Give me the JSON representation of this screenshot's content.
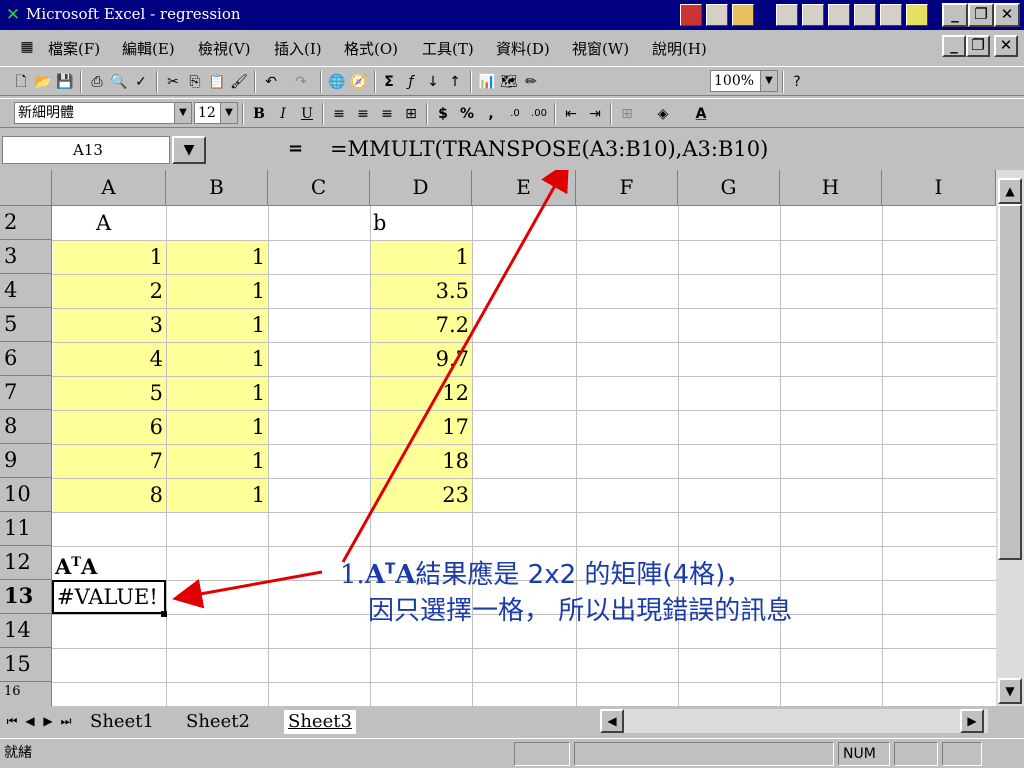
{
  "window": {
    "title": "Microsoft Excel - regression"
  },
  "menu": [
    "檔案(F)",
    "編輯(E)",
    "檢視(V)",
    "插入(I)",
    "格式(O)",
    "工具(T)",
    "資料(D)",
    "視窗(W)",
    "說明(H)"
  ],
  "toolbar": {
    "zoom": "100%",
    "font_name": "新細明體",
    "font_size": "12"
  },
  "formula_bar": {
    "name_box": "A13",
    "equals": "=",
    "formula": "=MMULT(TRANSPOSE(A3:B10),A3:B10)"
  },
  "columns": [
    "A",
    "B",
    "C",
    "D",
    "E",
    "F",
    "G",
    "H",
    "I"
  ],
  "rows": [
    "2",
    "3",
    "4",
    "5",
    "6",
    "7",
    "8",
    "9",
    "10",
    "11",
    "12",
    "13",
    "14",
    "15",
    "16"
  ],
  "cells": {
    "A2": "A",
    "D2": "b",
    "A_values": [
      "1",
      "2",
      "3",
      "4",
      "5",
      "6",
      "7",
      "8"
    ],
    "B_values": [
      "1",
      "1",
      "1",
      "1",
      "1",
      "1",
      "1",
      "1"
    ],
    "D_values": [
      "1",
      "3.5",
      "7.2",
      "9.7",
      "12",
      "17",
      "18",
      "23"
    ],
    "A12_base": "A",
    "A12_sup": "T",
    "A12_tail": "A",
    "A13": "#VALUE!"
  },
  "annotation": {
    "line1_prefix": "1.",
    "line1_a": "A",
    "line1_sup": "T",
    "line1_b": "A",
    "line1_rest": "結果應是 2x2 的矩陣(4格)，",
    "line2": "因只選擇一格，  所以出現錯誤的訊息",
    "color": "#1a3caa",
    "arrow_color": "#e00000"
  },
  "sheets": [
    "Sheet1",
    "Sheet2",
    "Sheet3"
  ],
  "active_sheet": "Sheet3",
  "status": {
    "ready": "就緒",
    "num": "NUM"
  }
}
